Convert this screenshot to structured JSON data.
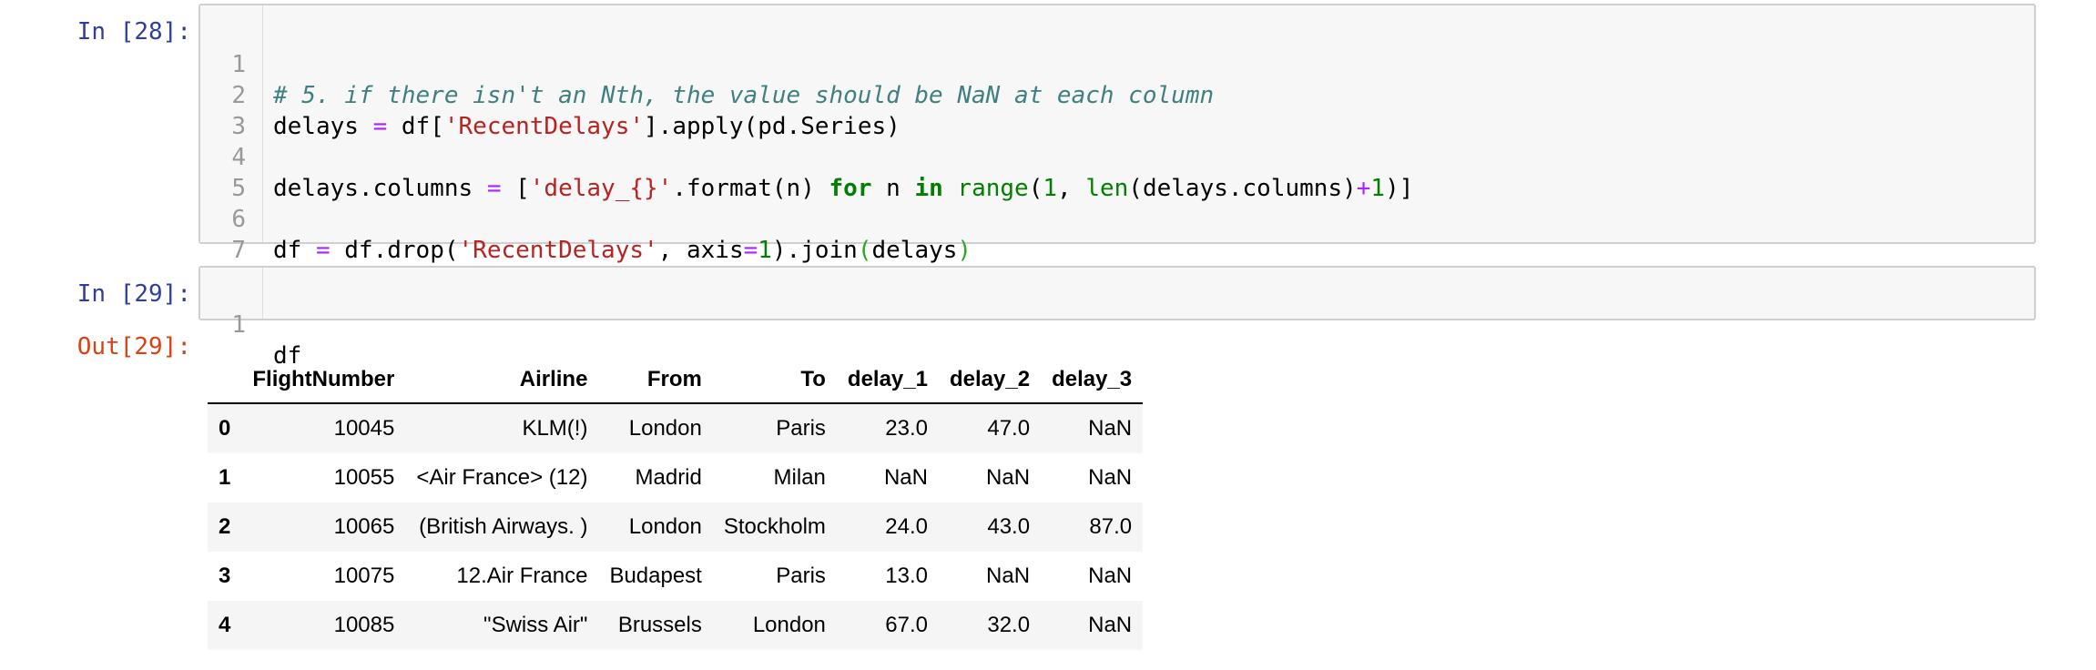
{
  "cells": [
    {
      "prompt": "In [28]:",
      "line_numbers": [
        "1",
        "2",
        "3",
        "4",
        "5",
        "6",
        "7"
      ]
    },
    {
      "prompt": "In [29]:",
      "line_numbers": [
        "1"
      ],
      "code": "df"
    }
  ],
  "code28": {
    "l1_comment": "# 5. if there isn't an Nth, the value should be NaN at each column",
    "l2_a": "delays ",
    "l2_op": "=",
    "l2_b": " df[",
    "l2_str": "'RecentDelays'",
    "l2_c": "].apply(pd.Series)",
    "l4_a": "delays.columns ",
    "l4_op": "=",
    "l4_b": " [",
    "l4_str": "'delay_{}'",
    "l4_c": ".format(n) ",
    "l4_kw1": "for",
    "l4_d": " n ",
    "l4_kw2": "in",
    "l4_e": " ",
    "l4_b1": "range",
    "l4_f": "(",
    "l4_n1": "1",
    "l4_g": ", ",
    "l4_b2": "len",
    "l4_h": "(delays.columns)",
    "l4_op2": "+",
    "l4_n2": "1",
    "l4_i": ")]",
    "l6_a": "df ",
    "l6_op": "=",
    "l6_b": " df.drop(",
    "l6_str": "'RecentDelays'",
    "l6_c": ", axis",
    "l6_op2": "=",
    "l6_n": "1",
    "l6_d": ").join",
    "l6_p1": "(",
    "l6_e": "delays",
    "l6_p2": ")"
  },
  "output": {
    "prompt": "Out[29]:",
    "columns": [
      "",
      "FlightNumber",
      "Airline",
      "From",
      "To",
      "delay_1",
      "delay_2",
      "delay_3"
    ],
    "rows": [
      [
        "0",
        "10045",
        "KLM(!)",
        "London",
        "Paris",
        "23.0",
        "47.0",
        "NaN"
      ],
      [
        "1",
        "10055",
        "<Air France> (12)",
        "Madrid",
        "Milan",
        "NaN",
        "NaN",
        "NaN"
      ],
      [
        "2",
        "10065",
        "(British Airways. )",
        "London",
        "Stockholm",
        "24.0",
        "43.0",
        "87.0"
      ],
      [
        "3",
        "10075",
        "12.Air France",
        "Budapest",
        "Paris",
        "13.0",
        "NaN",
        "NaN"
      ],
      [
        "4",
        "10085",
        "\"Swiss Air\"",
        "Brussels",
        "London",
        "67.0",
        "32.0",
        "NaN"
      ]
    ]
  }
}
